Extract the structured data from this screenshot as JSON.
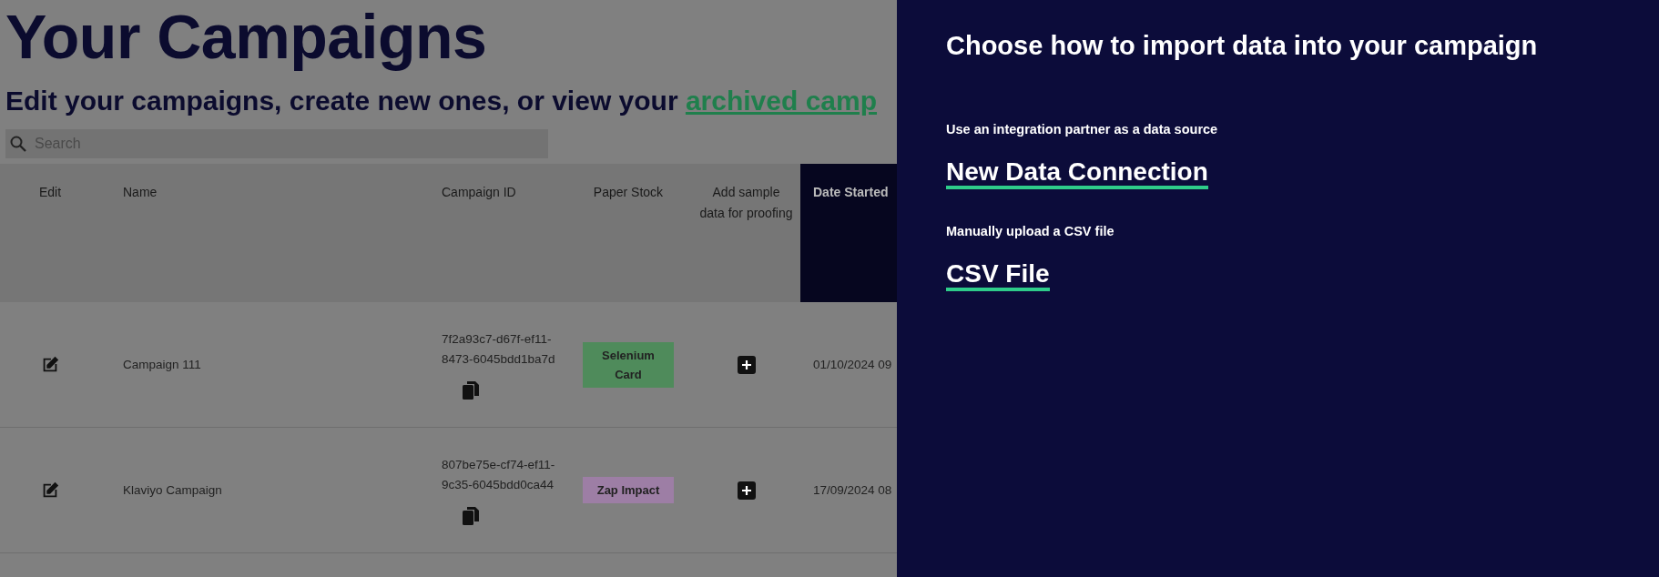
{
  "page": {
    "title": "Your Campaigns",
    "subtitle": "Edit your campaigns, create new ones, or view your ",
    "subtitle_link": "archived camp",
    "search": {
      "placeholder": "Search"
    }
  },
  "table": {
    "columns": [
      {
        "label": "Edit",
        "highlighted": false
      },
      {
        "label": "Name",
        "highlighted": false
      },
      {
        "label": "Campaign ID",
        "highlighted": false
      },
      {
        "label": "Paper Stock",
        "highlighted": false
      },
      {
        "label": "Add sample data for proofing",
        "highlighted": false
      },
      {
        "label": "Date Started",
        "highlighted": true
      }
    ],
    "rows": [
      {
        "name": "Campaign 111",
        "campaign_id": "7f2a93c7-d67f-ef11-8473-6045bdd1ba7d",
        "paper_stock": {
          "label": "Selenium Card",
          "color": "#4f8b5b"
        },
        "date_started": "01/10/2024 09"
      },
      {
        "name": "Klaviyo Campaign",
        "campaign_id": "807be75e-cf74-ef11-9c35-6045bdd0ca44",
        "paper_stock": {
          "label": "Zap Impact",
          "color": "#9d7ea5"
        },
        "date_started": "17/09/2024 08"
      }
    ]
  },
  "panel": {
    "title": "Choose how to import data into your campaign",
    "options": [
      {
        "description": "Use an integration partner as a data source",
        "link": "New Data Connection"
      },
      {
        "description": "Manually upload a CSV file",
        "link": "CSV File"
      }
    ]
  }
}
